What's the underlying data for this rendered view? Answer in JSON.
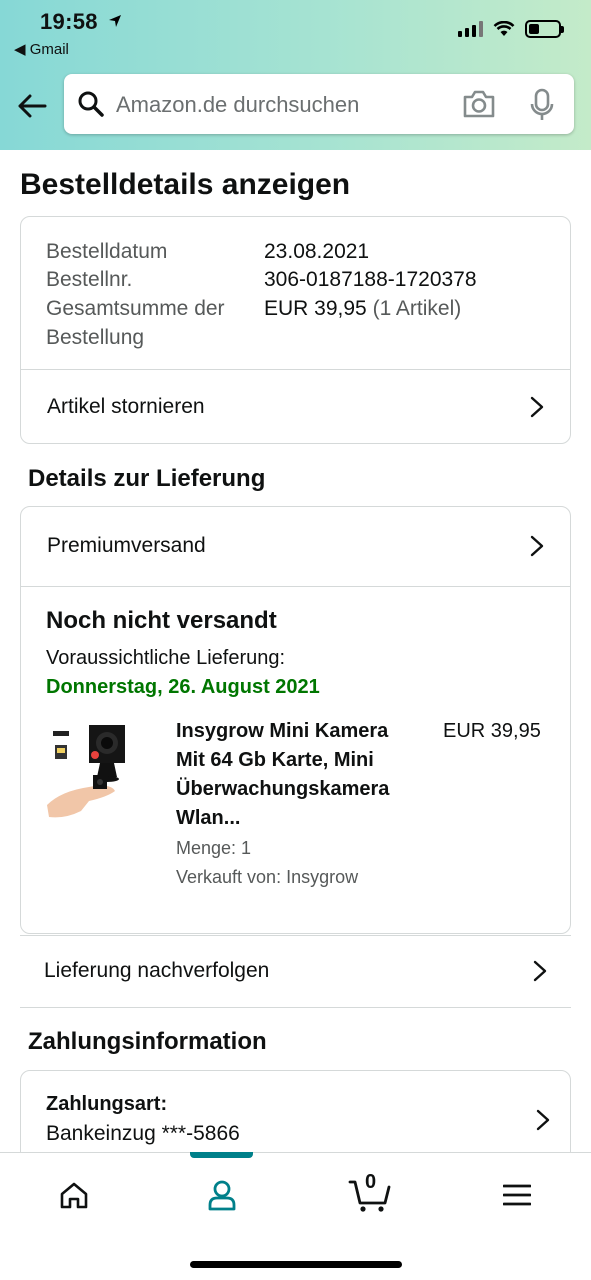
{
  "status": {
    "time": "19:58",
    "back_app": "◀ Gmail"
  },
  "search": {
    "placeholder": "Amazon.de durchsuchen"
  },
  "page": {
    "title": "Bestelldetails anzeigen"
  },
  "order_summary": {
    "date_label": "Bestelldatum",
    "date_value": "23.08.2021",
    "number_label": "Bestellnr.",
    "number_value": "306-0187188-1720378",
    "total_label_line1": "Gesamtsumme der",
    "total_label_line2": "Bestellung",
    "total_value": "EUR 39,95",
    "total_items": "(1 Artikel)",
    "cancel_label": "Artikel stornieren"
  },
  "delivery": {
    "heading": "Details zur Lieferung",
    "shipping_label": "Premiumversand",
    "status": "Noch nicht versandt",
    "expected_label": "Voraussichtliche Lieferung:",
    "expected_date": "Donnerstag, 26. August 2021",
    "item": {
      "title_lines": [
        "Insygrow Mini Kamera",
        "Mit 64 Gb Karte, Mini",
        "Überwachungskamera",
        "Wlan..."
      ],
      "price": "EUR 39,95",
      "quantity": "Menge: 1",
      "seller": "Verkauft von: Insygrow"
    },
    "track_label": "Lieferung nachverfolgen"
  },
  "payment": {
    "heading": "Zahlungsinformation",
    "method_label": "Zahlungsart:",
    "method_value": "Bankeinzug ***-5866"
  },
  "tabbar": {
    "cart_count": "0",
    "items": [
      "home-icon",
      "account-icon",
      "cart-icon",
      "menu-icon"
    ],
    "accent": "#00808a"
  },
  "colors": {
    "header_gradient_start": "#86d8d6",
    "header_gradient_end": "#c4ebc9",
    "delivery_green": "#007600"
  }
}
